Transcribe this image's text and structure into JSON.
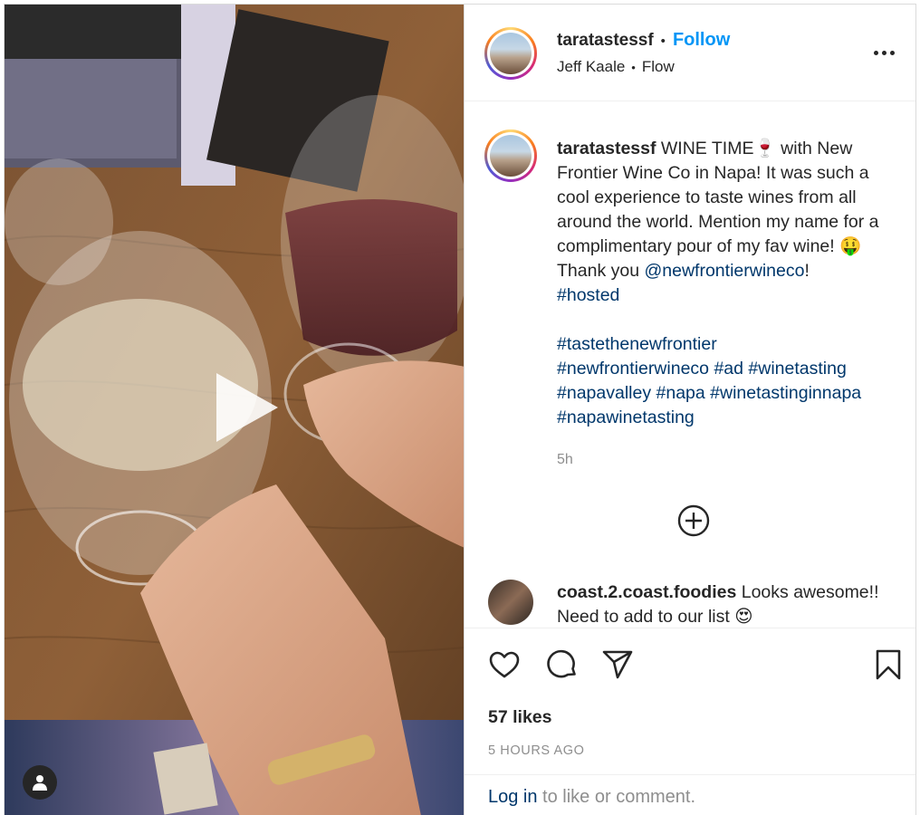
{
  "post": {
    "username": "taratastessf",
    "follow_label": "Follow",
    "separator": "•",
    "audio_artist": "Jeff Kaale",
    "audio_track": "Flow",
    "more_icon": "more-horizontal-icon",
    "media_type": "video"
  },
  "caption": {
    "username": "taratastessf",
    "text_1": " WINE TIME",
    "emoji_wine": "🍷",
    "text_2": " with New Frontier Wine Co in Napa! It was such a cool experience to taste wines from all around the world. Mention my name for a complimentary pour of my fav wine! ",
    "emoji_money": "🤑",
    "text_3": " Thank you ",
    "mention": "@newfrontierwineco",
    "text_4": "!",
    "tag_hosted": "#hosted",
    "tags": [
      "#tastethenewfrontier",
      "#newfrontierwineco",
      "#ad",
      "#winetasting",
      "#napavalley",
      "#napa",
      "#winetastinginnapa",
      "#napawinetasting"
    ],
    "time": "5h"
  },
  "comment": {
    "username": "coast.2.coast.foodies",
    "text": " Looks awesome!! Need to add to our list ",
    "emoji": "😍"
  },
  "actions": {
    "likes": "57 likes",
    "posted_ago": "5 HOURS AGO"
  },
  "login": {
    "link": "Log in",
    "rest": " to like or comment."
  },
  "colors": {
    "link": "#00376b",
    "follow": "#0095f6",
    "muted": "#8e8e8e"
  }
}
